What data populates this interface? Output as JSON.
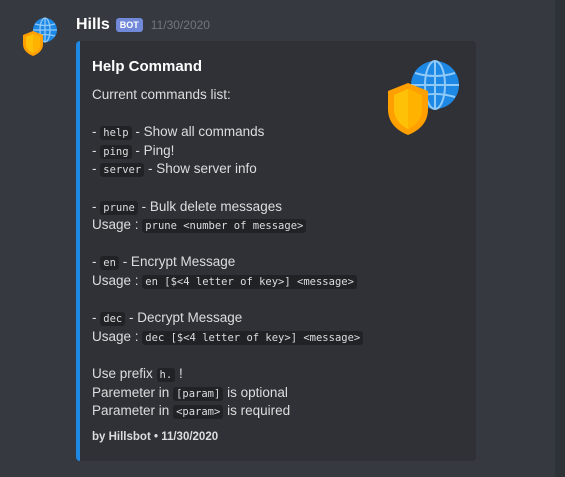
{
  "message": {
    "username": "Hills",
    "bot_tag": "BOT",
    "timestamp": "11/30/2020",
    "avatar_icon": "globe-shield-icon"
  },
  "embed": {
    "accent_color": "#1e88e5",
    "title": "Help Command",
    "thumbnail_icon": "globe-shield-icon",
    "intro": "Current commands list:",
    "commands": [
      {
        "name": "help",
        "desc": "- Show all commands"
      },
      {
        "name": "ping",
        "desc": "- Ping!"
      },
      {
        "name": "server",
        "desc": "- Show server info"
      },
      {
        "name": "prune",
        "desc": "- Bulk delete messages",
        "usage_label": "Usage :",
        "usage": "prune <number of message>"
      },
      {
        "name": "en",
        "desc": "- Encrypt Message",
        "usage_label": "Usage :",
        "usage": "en [$<4 letter of key>] <message>"
      },
      {
        "name": "dec",
        "desc": "- Decrypt Message",
        "usage_label": "Usage :",
        "usage": "dec [$<4 letter of key>] <message>"
      }
    ],
    "bullet": "-",
    "prefix_text": "Use prefix",
    "prefix_code": "h.",
    "prefix_suffix": "!",
    "param_optional": {
      "pre": "Paremeter in",
      "code": "[param]",
      "post": "is optional"
    },
    "param_required": {
      "pre": "Parameter in",
      "code": "<param>",
      "post": "is required"
    },
    "footer": "by Hillsbot • 11/30/2020"
  }
}
